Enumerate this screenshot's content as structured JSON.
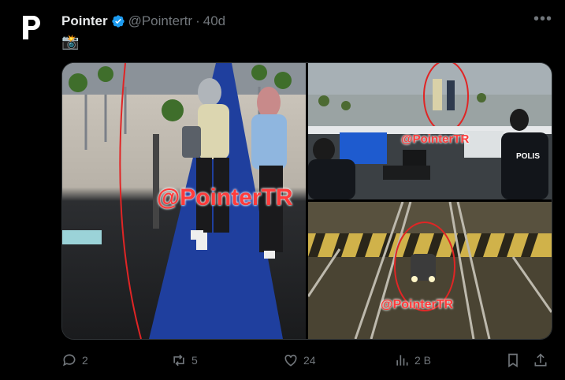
{
  "author": {
    "display_name": "Pointer",
    "handle": "@Pointertr",
    "separator": "·",
    "time": "40d",
    "verified": true
  },
  "post": {
    "emoji": "📸",
    "media": {
      "watermark_1": "@PointerTR",
      "watermark_2": "@PointerTR",
      "watermark_3": "@PointerTR",
      "police_label": "POLIS"
    }
  },
  "actions": {
    "reply_count": "2",
    "repost_count": "5",
    "like_count": "24",
    "views_count": "2 B"
  },
  "colors": {
    "background": "#000000",
    "text": "#e7e9ea",
    "muted": "#71767b",
    "verified_blue": "#1d9bf0",
    "watermark_red": "#ff3b3b"
  }
}
